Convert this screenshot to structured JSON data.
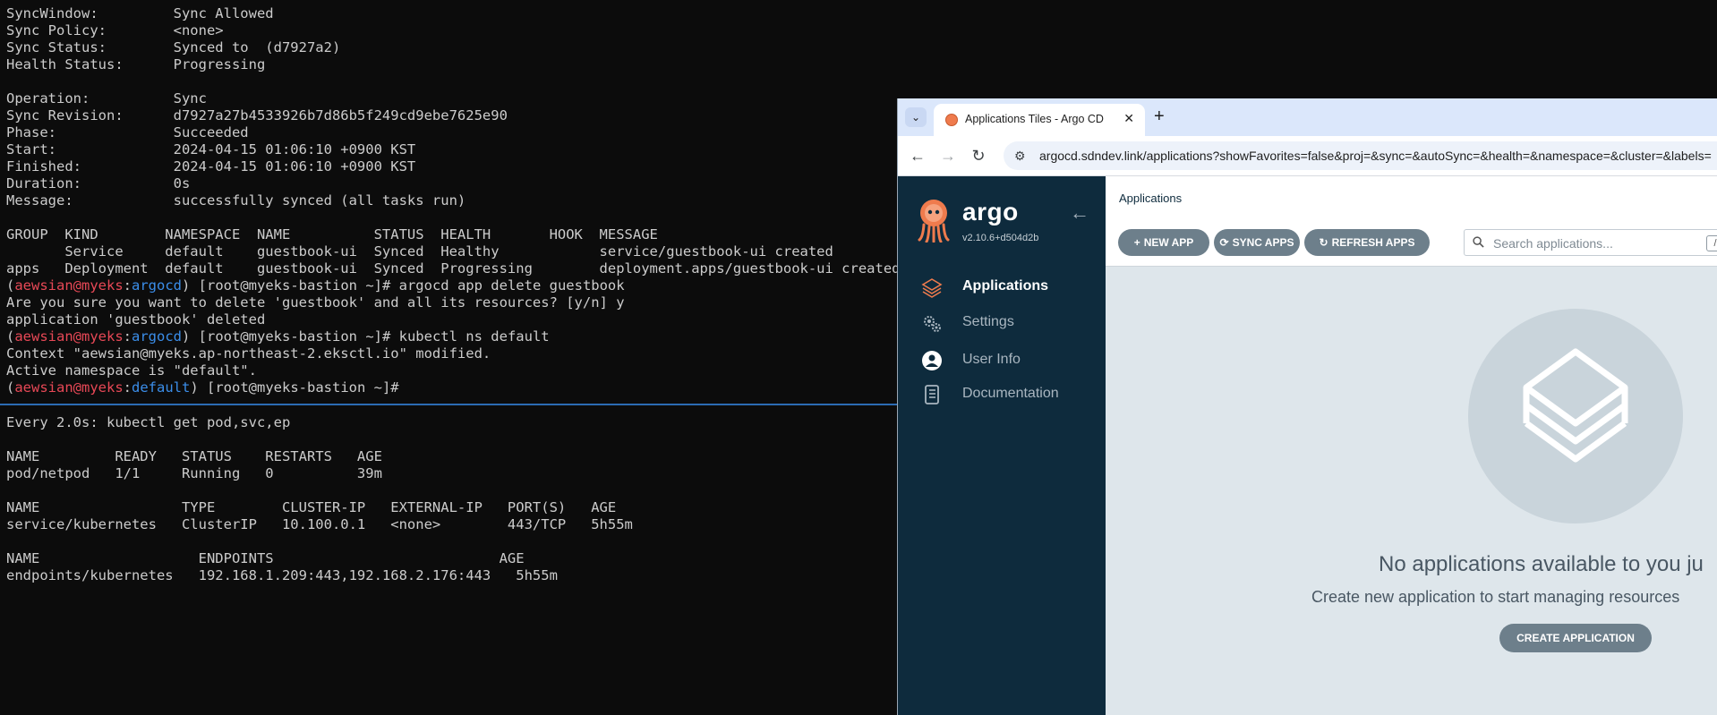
{
  "terminal_top": {
    "lines": [
      {
        "segments": [
          {
            "text": "SyncWindow:         Sync Allowed"
          }
        ]
      },
      {
        "segments": [
          {
            "text": "Sync Policy:        <none>"
          }
        ]
      },
      {
        "segments": [
          {
            "text": "Sync Status:        Synced to  (d7927a2)"
          }
        ]
      },
      {
        "segments": [
          {
            "text": "Health Status:      Progressing"
          }
        ]
      },
      {
        "segments": [
          {
            "text": ""
          }
        ]
      },
      {
        "segments": [
          {
            "text": "Operation:          Sync"
          }
        ]
      },
      {
        "segments": [
          {
            "text": "Sync Revision:      d7927a27b4533926b7d86b5f249cd9ebe7625e90"
          }
        ]
      },
      {
        "segments": [
          {
            "text": "Phase:              Succeeded"
          }
        ]
      },
      {
        "segments": [
          {
            "text": "Start:              2024-04-15 01:06:10 +0900 KST"
          }
        ]
      },
      {
        "segments": [
          {
            "text": "Finished:           2024-04-15 01:06:10 +0900 KST"
          }
        ]
      },
      {
        "segments": [
          {
            "text": "Duration:           0s"
          }
        ]
      },
      {
        "segments": [
          {
            "text": "Message:            successfully synced (all tasks run)"
          }
        ]
      },
      {
        "segments": [
          {
            "text": ""
          }
        ]
      },
      {
        "segments": [
          {
            "text": "GROUP  KIND        NAMESPACE  NAME          STATUS  HEALTH       HOOK  MESSAGE"
          }
        ]
      },
      {
        "segments": [
          {
            "text": "       Service     default    guestbook-ui  Synced  Healthy            service/guestbook-ui created"
          }
        ]
      },
      {
        "segments": [
          {
            "text": "apps   Deployment  default    guestbook-ui  Synced  Progressing        deployment.apps/guestbook-ui created"
          }
        ]
      },
      {
        "segments": [
          {
            "text": "("
          },
          {
            "text": "aewsian@myeks",
            "color": "red"
          },
          {
            "text": ":"
          },
          {
            "text": "argocd",
            "color": "blue"
          },
          {
            "text": ") [root@myeks-bastion ~]# argocd app delete guestbook"
          }
        ]
      },
      {
        "segments": [
          {
            "text": "Are you sure you want to delete 'guestbook' and all its resources? [y/n] y"
          }
        ]
      },
      {
        "segments": [
          {
            "text": "application 'guestbook' deleted"
          }
        ]
      },
      {
        "segments": [
          {
            "text": "("
          },
          {
            "text": "aewsian@myeks",
            "color": "red"
          },
          {
            "text": ":"
          },
          {
            "text": "argocd",
            "color": "blue"
          },
          {
            "text": ") [root@myeks-bastion ~]# kubectl ns default"
          }
        ]
      },
      {
        "segments": [
          {
            "text": "Context \"aewsian@myeks.ap-northeast-2.eksctl.io\" modified."
          }
        ]
      },
      {
        "segments": [
          {
            "text": "Active namespace is \"default\"."
          }
        ]
      },
      {
        "segments": [
          {
            "text": "("
          },
          {
            "text": "aewsian@myeks",
            "color": "red"
          },
          {
            "text": ":"
          },
          {
            "text": "default",
            "color": "blue"
          },
          {
            "text": ") [root@myeks-bastion ~]#"
          }
        ]
      }
    ]
  },
  "terminal_bottom": {
    "lines": [
      {
        "segments": [
          {
            "text": "Every 2.0s: kubectl get pod,svc,ep"
          }
        ]
      },
      {
        "segments": [
          {
            "text": ""
          }
        ]
      },
      {
        "segments": [
          {
            "text": "NAME         READY   STATUS    RESTARTS   AGE"
          }
        ]
      },
      {
        "segments": [
          {
            "text": "pod/netpod   1/1     Running   0          39m"
          }
        ]
      },
      {
        "segments": [
          {
            "text": ""
          }
        ]
      },
      {
        "segments": [
          {
            "text": "NAME                 TYPE        CLUSTER-IP   EXTERNAL-IP   PORT(S)   AGE"
          }
        ]
      },
      {
        "segments": [
          {
            "text": "service/kubernetes   ClusterIP   10.100.0.1   <none>        443/TCP   5h55m"
          }
        ]
      },
      {
        "segments": [
          {
            "text": ""
          }
        ]
      },
      {
        "segments": [
          {
            "text": "NAME                   ENDPOINTS                           AGE"
          }
        ]
      },
      {
        "segments": [
          {
            "text": "endpoints/kubernetes   192.168.1.209:443,192.168.2.176:443   5h55m"
          }
        ]
      }
    ]
  },
  "colors": {
    "red": "#e74856",
    "blue": "#3b8eea",
    "accent": "#6d7f8b",
    "sidebar": "#0e2b3d"
  },
  "browser": {
    "tab_list_glyph": "⌄",
    "tab_title": "Applications Tiles - Argo CD",
    "tab_close_glyph": "✕",
    "new_tab_glyph": "+",
    "back_glyph": "←",
    "forward_glyph": "→",
    "reload_glyph": "↻",
    "site_info_glyph": "⚙",
    "url": "argocd.sdndev.link/applications?showFavorites=false&proj=&sync=&autoSync=&health=&namespace=&cluster=&labels="
  },
  "argo": {
    "brand": "argo",
    "version": "v2.10.6+d504d2b",
    "collapse_glyph": "←",
    "nav": [
      {
        "label": "Applications",
        "icon": "layers-icon",
        "active": true
      },
      {
        "label": "Settings",
        "icon": "gears-icon",
        "active": false
      },
      {
        "label": "User Info",
        "icon": "user-icon",
        "active": false
      },
      {
        "label": "Documentation",
        "icon": "documentation-icon",
        "active": false
      }
    ],
    "page_heading": "Applications",
    "buttons": {
      "new_app": {
        "glyph": "+",
        "label": "NEW APP"
      },
      "sync_apps": {
        "glyph": "⟳",
        "label": "SYNC APPS"
      },
      "refresh_apps": {
        "glyph": "↻",
        "label": "REFRESH APPS"
      }
    },
    "search": {
      "placeholder": "Search applications...",
      "shortcut": "/"
    },
    "empty_state": {
      "title": "No applications available to you ju",
      "subtitle": "Create new application to start managing resources",
      "button": "CREATE APPLICATION"
    }
  }
}
